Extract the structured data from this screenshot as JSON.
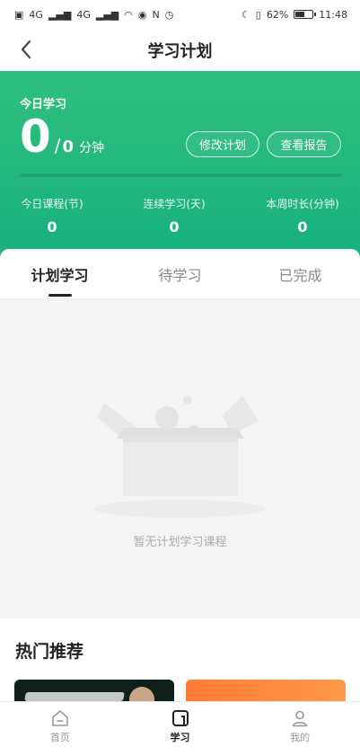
{
  "status_bar": {
    "network_left": "4G",
    "network_right": "4G",
    "battery_percent": "62%",
    "battery_level": 0.62,
    "time": "11:48"
  },
  "navbar": {
    "title": "学习计划",
    "back_icon": "chevron-left-icon"
  },
  "today": {
    "label": "今日学习",
    "value": "0",
    "slash": "/",
    "goal": "0",
    "unit": "分钟",
    "progress": 0,
    "modify_button": "修改计划",
    "report_button": "查看报告"
  },
  "stats": [
    {
      "label": "今日课程(节)",
      "value": "0"
    },
    {
      "label": "连续学习(天)",
      "value": "0"
    },
    {
      "label": "本周时长(分钟)",
      "value": "0"
    }
  ],
  "tabs": [
    {
      "label": "计划学习",
      "active": true
    },
    {
      "label": "待学习",
      "active": false
    },
    {
      "label": "已完成",
      "active": false
    }
  ],
  "empty_state": {
    "icon": "empty-box-icon",
    "text": "暂无计划学习课程"
  },
  "hot": {
    "title": "热门推荐"
  },
  "bottom_nav": [
    {
      "label": "首页",
      "icon": "home-icon",
      "active": false
    },
    {
      "label": "学习",
      "icon": "study-icon",
      "active": true
    },
    {
      "label": "我的",
      "icon": "profile-icon",
      "active": false
    }
  ],
  "colors": {
    "accent_green": "#2fc07c",
    "accent_green_dark": "#17b07f",
    "text_primary": "#222222",
    "text_secondary": "#888888"
  }
}
